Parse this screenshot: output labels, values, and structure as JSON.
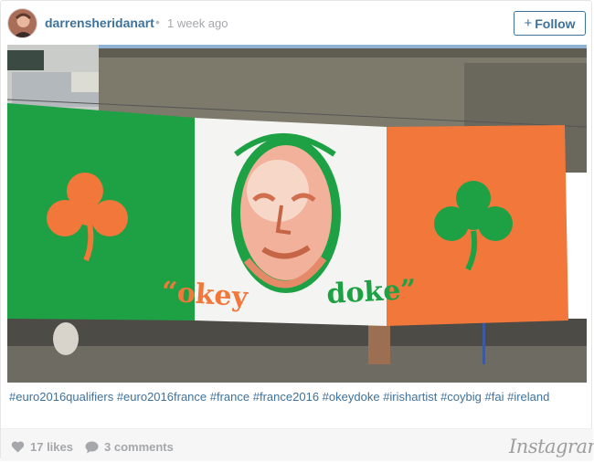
{
  "post": {
    "username": "darrensheridanart",
    "separator": "•",
    "time_ago": "1 week ago",
    "follow_label": "Follow",
    "follow_plus": "+"
  },
  "image": {
    "flag_text_left": "“okey",
    "flag_text_right": "doke”"
  },
  "caption": {
    "hashtags": [
      "#euro2016qualifiers",
      "#euro2016france",
      "#france",
      "#france2016",
      "#okeydoke",
      "#irishartist",
      "#coybig",
      "#fai",
      "#ireland"
    ]
  },
  "footer": {
    "likes": "17 likes",
    "comments": "3 comments",
    "brand": "Instagram"
  },
  "colors": {
    "link_blue": "#3f729b",
    "muted_gray": "#a5a7aa",
    "flag_green": "#1ea144",
    "flag_orange": "#f2773a"
  }
}
